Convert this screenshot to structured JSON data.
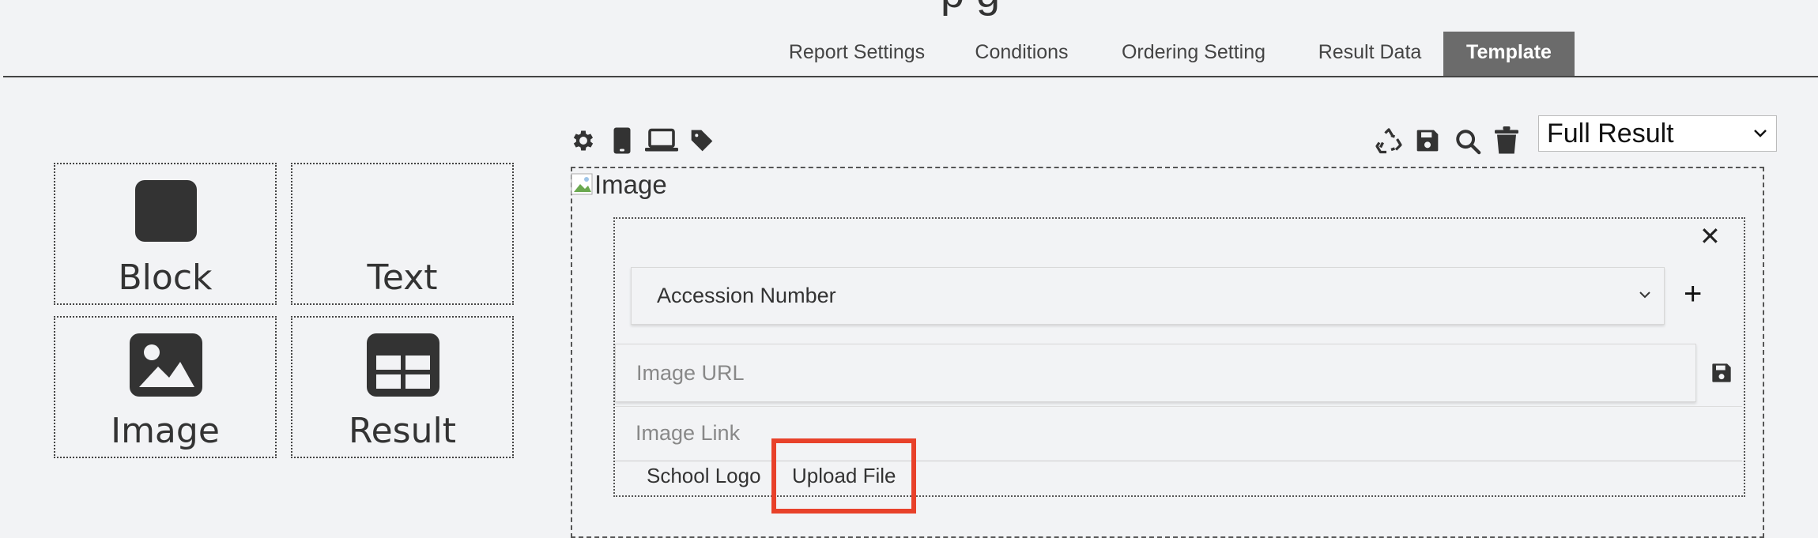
{
  "header": {
    "title_fragment": "p      g"
  },
  "tabs": [
    {
      "label": "Report Settings",
      "active": false
    },
    {
      "label": "Conditions",
      "active": false
    },
    {
      "label": "Ordering Setting",
      "active": false
    },
    {
      "label": "Result Data",
      "active": false
    },
    {
      "label": "Template",
      "active": true
    }
  ],
  "components": {
    "block": "Block",
    "text": "Text",
    "image": "Image",
    "result": "Result"
  },
  "toolbar": {
    "left_icons": [
      "gear-icon",
      "mobile-icon",
      "laptop-icon",
      "tag-icon"
    ],
    "right_icons": [
      "recycle-icon",
      "save-icon",
      "search-icon",
      "trash-icon"
    ],
    "template_select": "Full Result"
  },
  "canvas": {
    "broken_image_alt": "Image",
    "field_select": "Accession Number",
    "image_url_placeholder": "Image URL",
    "image_link_placeholder": "Image Link",
    "source_tabs": [
      "School Logo",
      "Upload File"
    ]
  },
  "colors": {
    "active_tab": "#6b6b6b",
    "highlight": "#e8412a"
  }
}
